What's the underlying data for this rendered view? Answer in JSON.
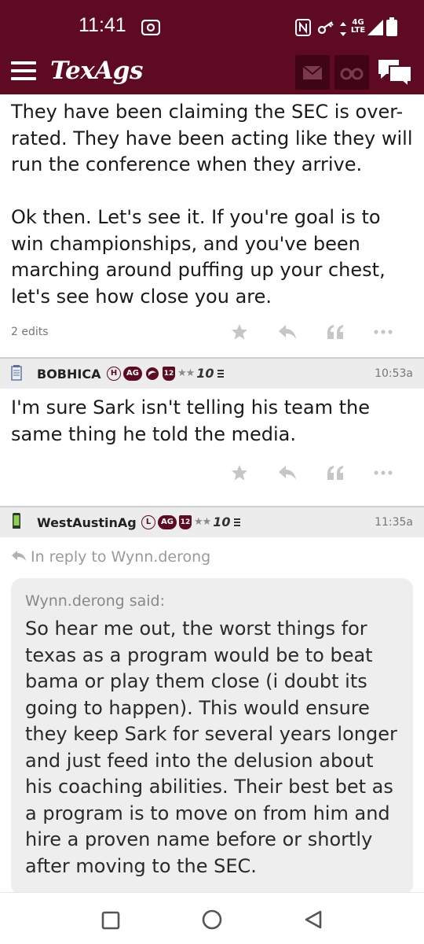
{
  "status_bar": {
    "time": "11:41",
    "network": "4G LTE",
    "icons": [
      "screen-record-icon",
      "nfc-icon",
      "key-icon",
      "data-arrows-icon",
      "signal-icon",
      "battery-icon"
    ]
  },
  "nav": {
    "logo": "TexAgs",
    "icons": [
      "menu-icon",
      "mail-icon",
      "binoculars-icon",
      "chat-icon"
    ]
  },
  "colors": {
    "brand": "#5d0a22",
    "header_bg": "#ececec",
    "quote_bg": "#eeeeee"
  },
  "posts": [
    {
      "paragraphs": [
        "They have been claiming the SEC is over-rated. They have been acting like they will run the conference when they arrive.",
        "Ok then. Let's see it. If you're goal is to win championships, and you've been marching around puffing up your chest, let's see how close you are."
      ],
      "edits": "2 edits"
    },
    {
      "username": "BOBHICA",
      "badges": {
        "b1": "H",
        "b2": "AG",
        "b4": "12",
        "stars": "★★",
        "rank": "10"
      },
      "time": "10:53a",
      "body": "I'm sure Sark isn't telling his team the same thing he told the media."
    },
    {
      "username": "WestAustinAg",
      "badges": {
        "b1": "L",
        "b2": "AG",
        "b3": "12",
        "stars": "★★",
        "rank": "10"
      },
      "time": "11:35a",
      "reply_to": "In reply to Wynn.derong",
      "quote_author": "Wynn.derong said:",
      "quote_body": "So hear me out, the worst things for texas as a program would be to beat bama or play them close (i doubt its going to happen). This would ensure they keep Sark for several years longer and just feed into the delusion about his coaching abilities. Their best bet as a program is to move on from him and hire a proven name before or shortly after moving to the SEC."
    }
  ],
  "system_nav": [
    "recents-square-icon",
    "home-circle-icon",
    "back-triangle-icon"
  ]
}
